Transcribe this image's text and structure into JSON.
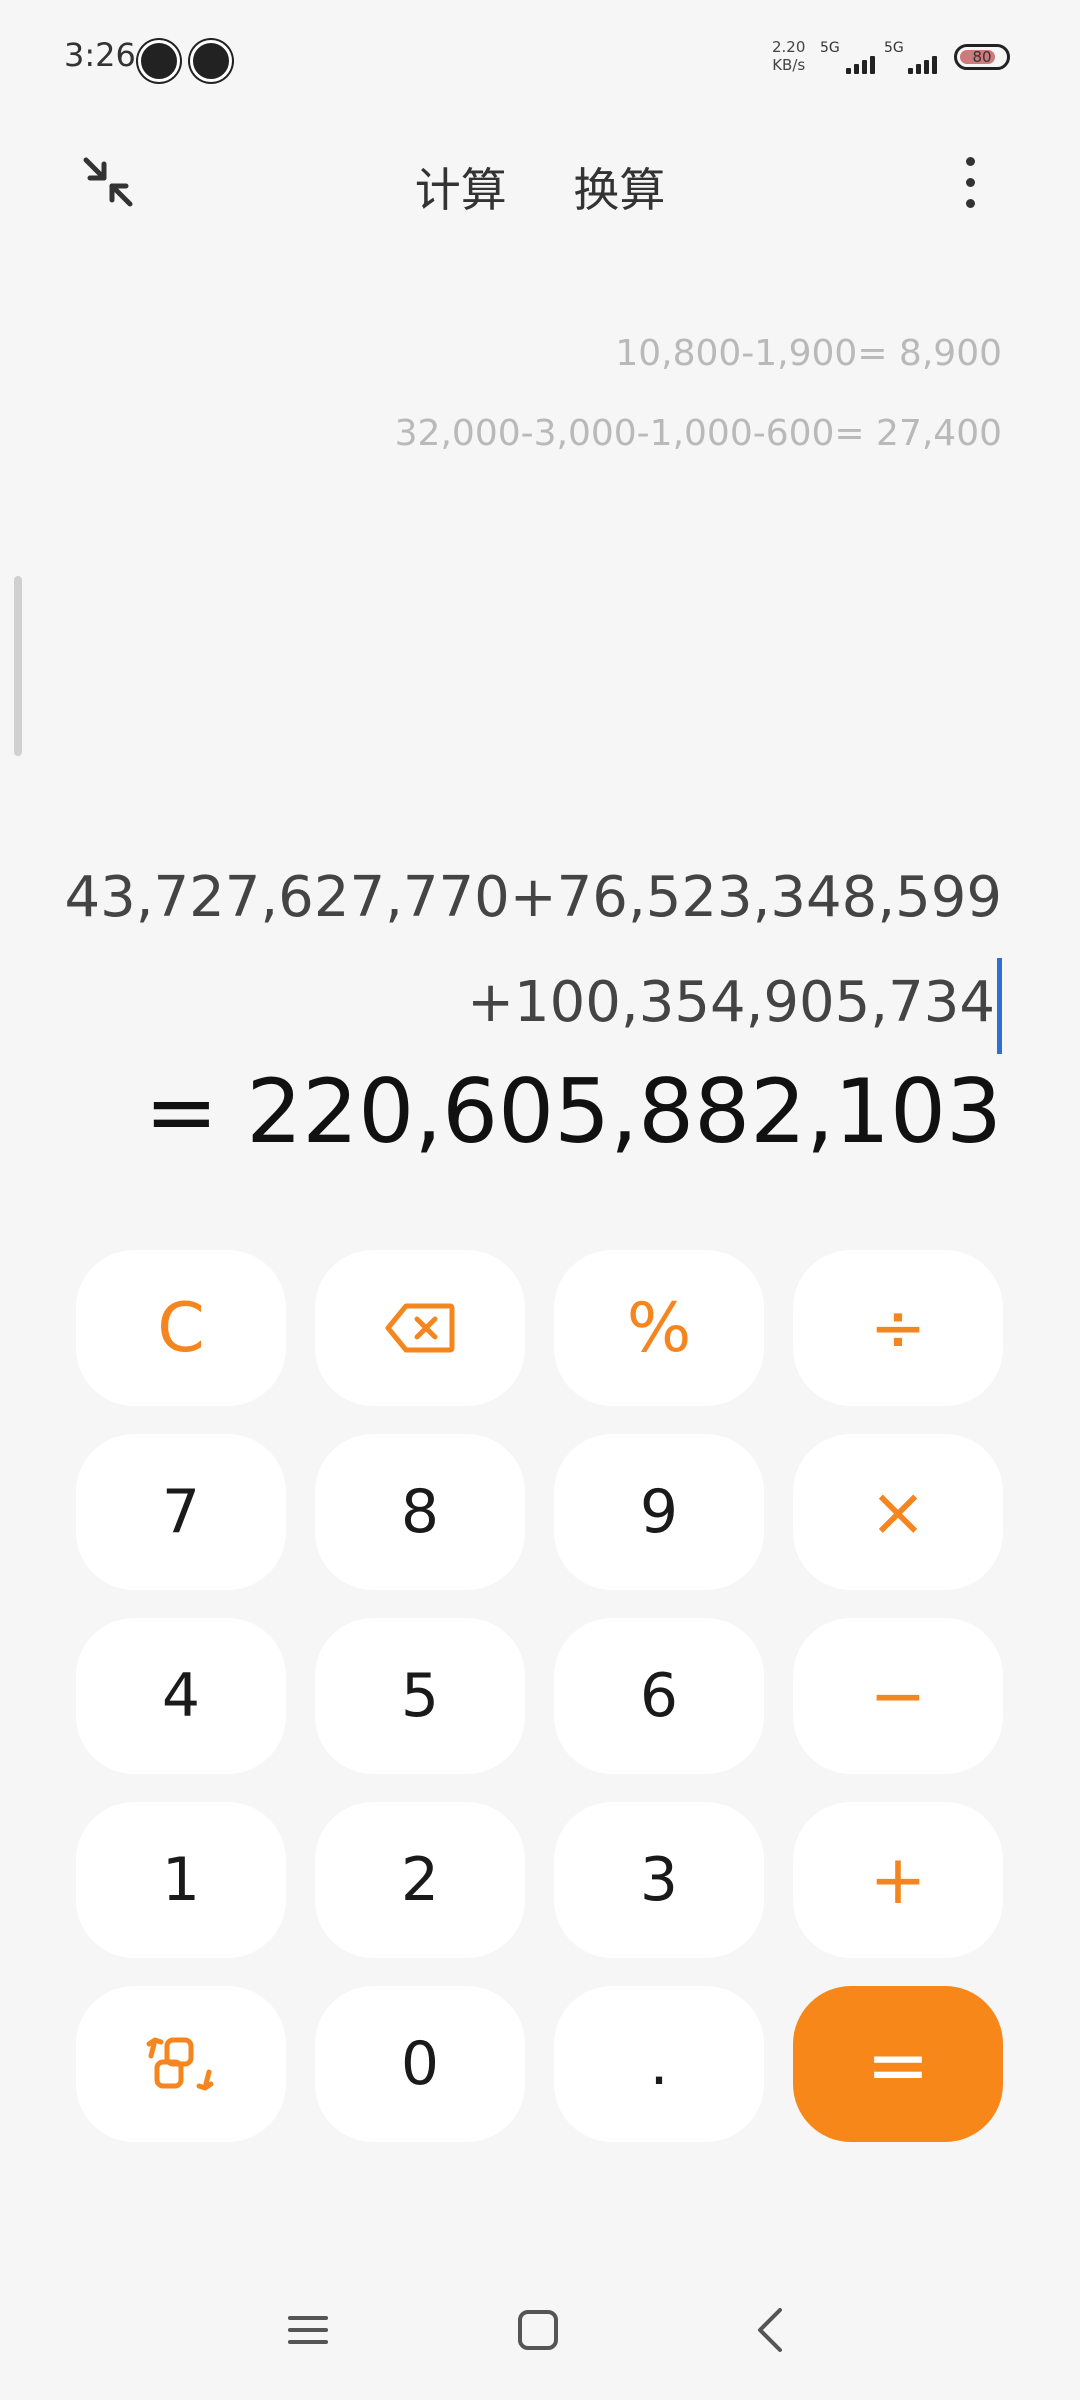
{
  "status_bar": {
    "time": "3:26",
    "net_speed_value": "2.20",
    "net_speed_unit": "KB/s",
    "network_1": "5G",
    "network_2": "5G",
    "battery": "80"
  },
  "header": {
    "tabs": [
      {
        "label": "计算",
        "active": true
      },
      {
        "label": "换算",
        "active": false
      }
    ]
  },
  "history": [
    "10,800-1,900= 8,900",
    "32,000-3,000-1,000-600= 27,400"
  ],
  "expression": {
    "line1": "43,727,627,770+76,523,348,599",
    "line2": "+100,354,905,734"
  },
  "result": "= 220,605,882,103",
  "keypad": {
    "clear": "C",
    "percent": "%",
    "divide": "÷",
    "seven": "7",
    "eight": "8",
    "nine": "9",
    "multiply": "×",
    "four": "4",
    "five": "5",
    "six": "6",
    "minus": "−",
    "one": "1",
    "two": "2",
    "three": "3",
    "plus": "+",
    "zero": "0",
    "decimal": ".",
    "equals": "="
  },
  "colors": {
    "accent": "#f5861f",
    "equals_bg": "#f8871a",
    "background": "#f6f6f6",
    "key_bg": "#ffffff",
    "cursor": "#2f6fd4"
  },
  "icons": {
    "collapse": "collapse-arrows-icon",
    "more": "more-vertical-icon",
    "backspace": "backspace-icon",
    "switch_mode": "switch-mode-icon",
    "nav_menu": "menu-lines-icon",
    "nav_home": "home-square-icon",
    "nav_back": "back-chevron-icon"
  }
}
